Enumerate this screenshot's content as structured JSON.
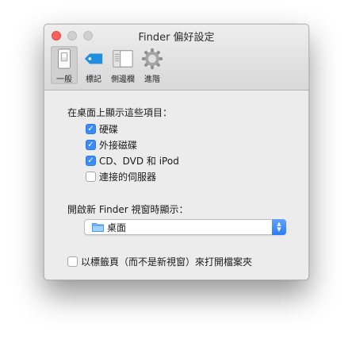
{
  "window": {
    "title": "Finder 偏好設定"
  },
  "toolbar": {
    "items": [
      {
        "label": "一般",
        "icon": "general-switch-icon",
        "active": true
      },
      {
        "label": "標記",
        "icon": "tag-icon",
        "active": false
      },
      {
        "label": "側邊欄",
        "icon": "sidebar-icon",
        "active": false
      },
      {
        "label": "進階",
        "icon": "gear-icon",
        "active": false
      }
    ]
  },
  "desktop_section": {
    "heading": "在桌面上顯示這些項目：",
    "items": [
      {
        "label": "硬碟",
        "checked": true
      },
      {
        "label": "外接磁碟",
        "checked": true
      },
      {
        "label": "CD、DVD 和 iPod",
        "checked": true
      },
      {
        "label": "連接的伺服器",
        "checked": false
      }
    ]
  },
  "new_window_section": {
    "heading": "開啟新 Finder 視窗時顯示：",
    "selected": "桌面",
    "selected_icon": "folder-icon"
  },
  "tabs_option": {
    "label": "以標籤頁（而不是新視窗）來打開檔案夾",
    "checked": false
  },
  "colors": {
    "accent": "#3b8cfa",
    "close": "#fc605c",
    "tag": "#1f8fe0"
  }
}
